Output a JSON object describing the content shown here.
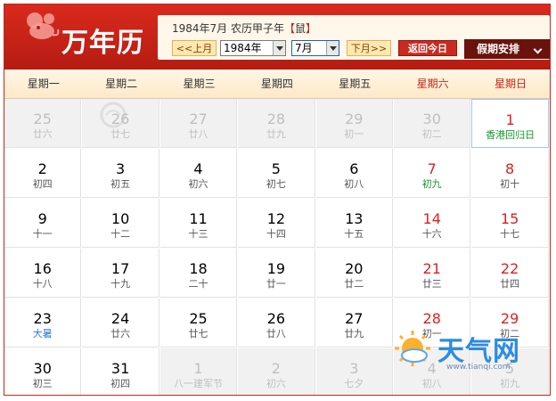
{
  "header": {
    "title": "万年历",
    "info_prefix": "1984年7月 农历甲子年",
    "info_zodiac_open": "【",
    "info_zodiac": "鼠",
    "info_zodiac_close": "】",
    "prev_month": "<<上月",
    "year_select": "1984年",
    "month_select": "7月",
    "next_month": "下月>>",
    "today_button": "返回今日",
    "holiday_button": "假期安排"
  },
  "weekdays": [
    "星期一",
    "星期二",
    "星期三",
    "星期四",
    "星期五",
    "星期六",
    "星期日"
  ],
  "weeks": [
    [
      {
        "day": "25",
        "sub": "廿六",
        "other": true
      },
      {
        "day": "26",
        "sub": "廿七",
        "other": true
      },
      {
        "day": "27",
        "sub": "廿八",
        "other": true
      },
      {
        "day": "28",
        "sub": "廿九",
        "other": true
      },
      {
        "day": "29",
        "sub": "初一",
        "other": true
      },
      {
        "day": "30",
        "sub": "初二",
        "other": true
      },
      {
        "day": "1",
        "sub": "香港回归日",
        "day_color": "red",
        "sub_color": "green",
        "today": true
      }
    ],
    [
      {
        "day": "2",
        "sub": "初四"
      },
      {
        "day": "3",
        "sub": "初五"
      },
      {
        "day": "4",
        "sub": "初六"
      },
      {
        "day": "5",
        "sub": "初七"
      },
      {
        "day": "6",
        "sub": "初八"
      },
      {
        "day": "7",
        "sub": "初九",
        "day_color": "red",
        "sub_color": "green"
      },
      {
        "day": "8",
        "sub": "初十",
        "day_color": "red"
      }
    ],
    [
      {
        "day": "9",
        "sub": "十一"
      },
      {
        "day": "10",
        "sub": "十二"
      },
      {
        "day": "11",
        "sub": "十三"
      },
      {
        "day": "12",
        "sub": "十四"
      },
      {
        "day": "13",
        "sub": "十五"
      },
      {
        "day": "14",
        "sub": "十六",
        "day_color": "red"
      },
      {
        "day": "15",
        "sub": "十七",
        "day_color": "red"
      }
    ],
    [
      {
        "day": "16",
        "sub": "十八"
      },
      {
        "day": "17",
        "sub": "十九"
      },
      {
        "day": "18",
        "sub": "二十"
      },
      {
        "day": "19",
        "sub": "廿一"
      },
      {
        "day": "20",
        "sub": "廿二"
      },
      {
        "day": "21",
        "sub": "廿三",
        "day_color": "red"
      },
      {
        "day": "22",
        "sub": "廿四",
        "day_color": "red"
      }
    ],
    [
      {
        "day": "23",
        "sub": "大暑",
        "sub_color": "blue"
      },
      {
        "day": "24",
        "sub": "廿六"
      },
      {
        "day": "25",
        "sub": "廿七"
      },
      {
        "day": "26",
        "sub": "廿八"
      },
      {
        "day": "27",
        "sub": "廿九"
      },
      {
        "day": "28",
        "sub": "初一",
        "day_color": "red"
      },
      {
        "day": "29",
        "sub": "初二",
        "day_color": "red"
      }
    ],
    [
      {
        "day": "30",
        "sub": "初三"
      },
      {
        "day": "31",
        "sub": "初四"
      },
      {
        "day": "1",
        "sub": "八一建军节",
        "other": true,
        "sub_color": "green"
      },
      {
        "day": "2",
        "sub": "初六",
        "other": true
      },
      {
        "day": "3",
        "sub": "七夕",
        "other": true,
        "sub_color": "red"
      },
      {
        "day": "4",
        "sub": "初八",
        "other": true
      },
      {
        "day": "5",
        "sub": "初九",
        "other": true
      }
    ]
  ],
  "watermark": {
    "name": "天气网",
    "url": "www.tianqi.com"
  },
  "colors": {
    "brand_red": "#c7251a",
    "holiday_green": "#139a2b",
    "solar_term_blue": "#2b7ad8"
  }
}
